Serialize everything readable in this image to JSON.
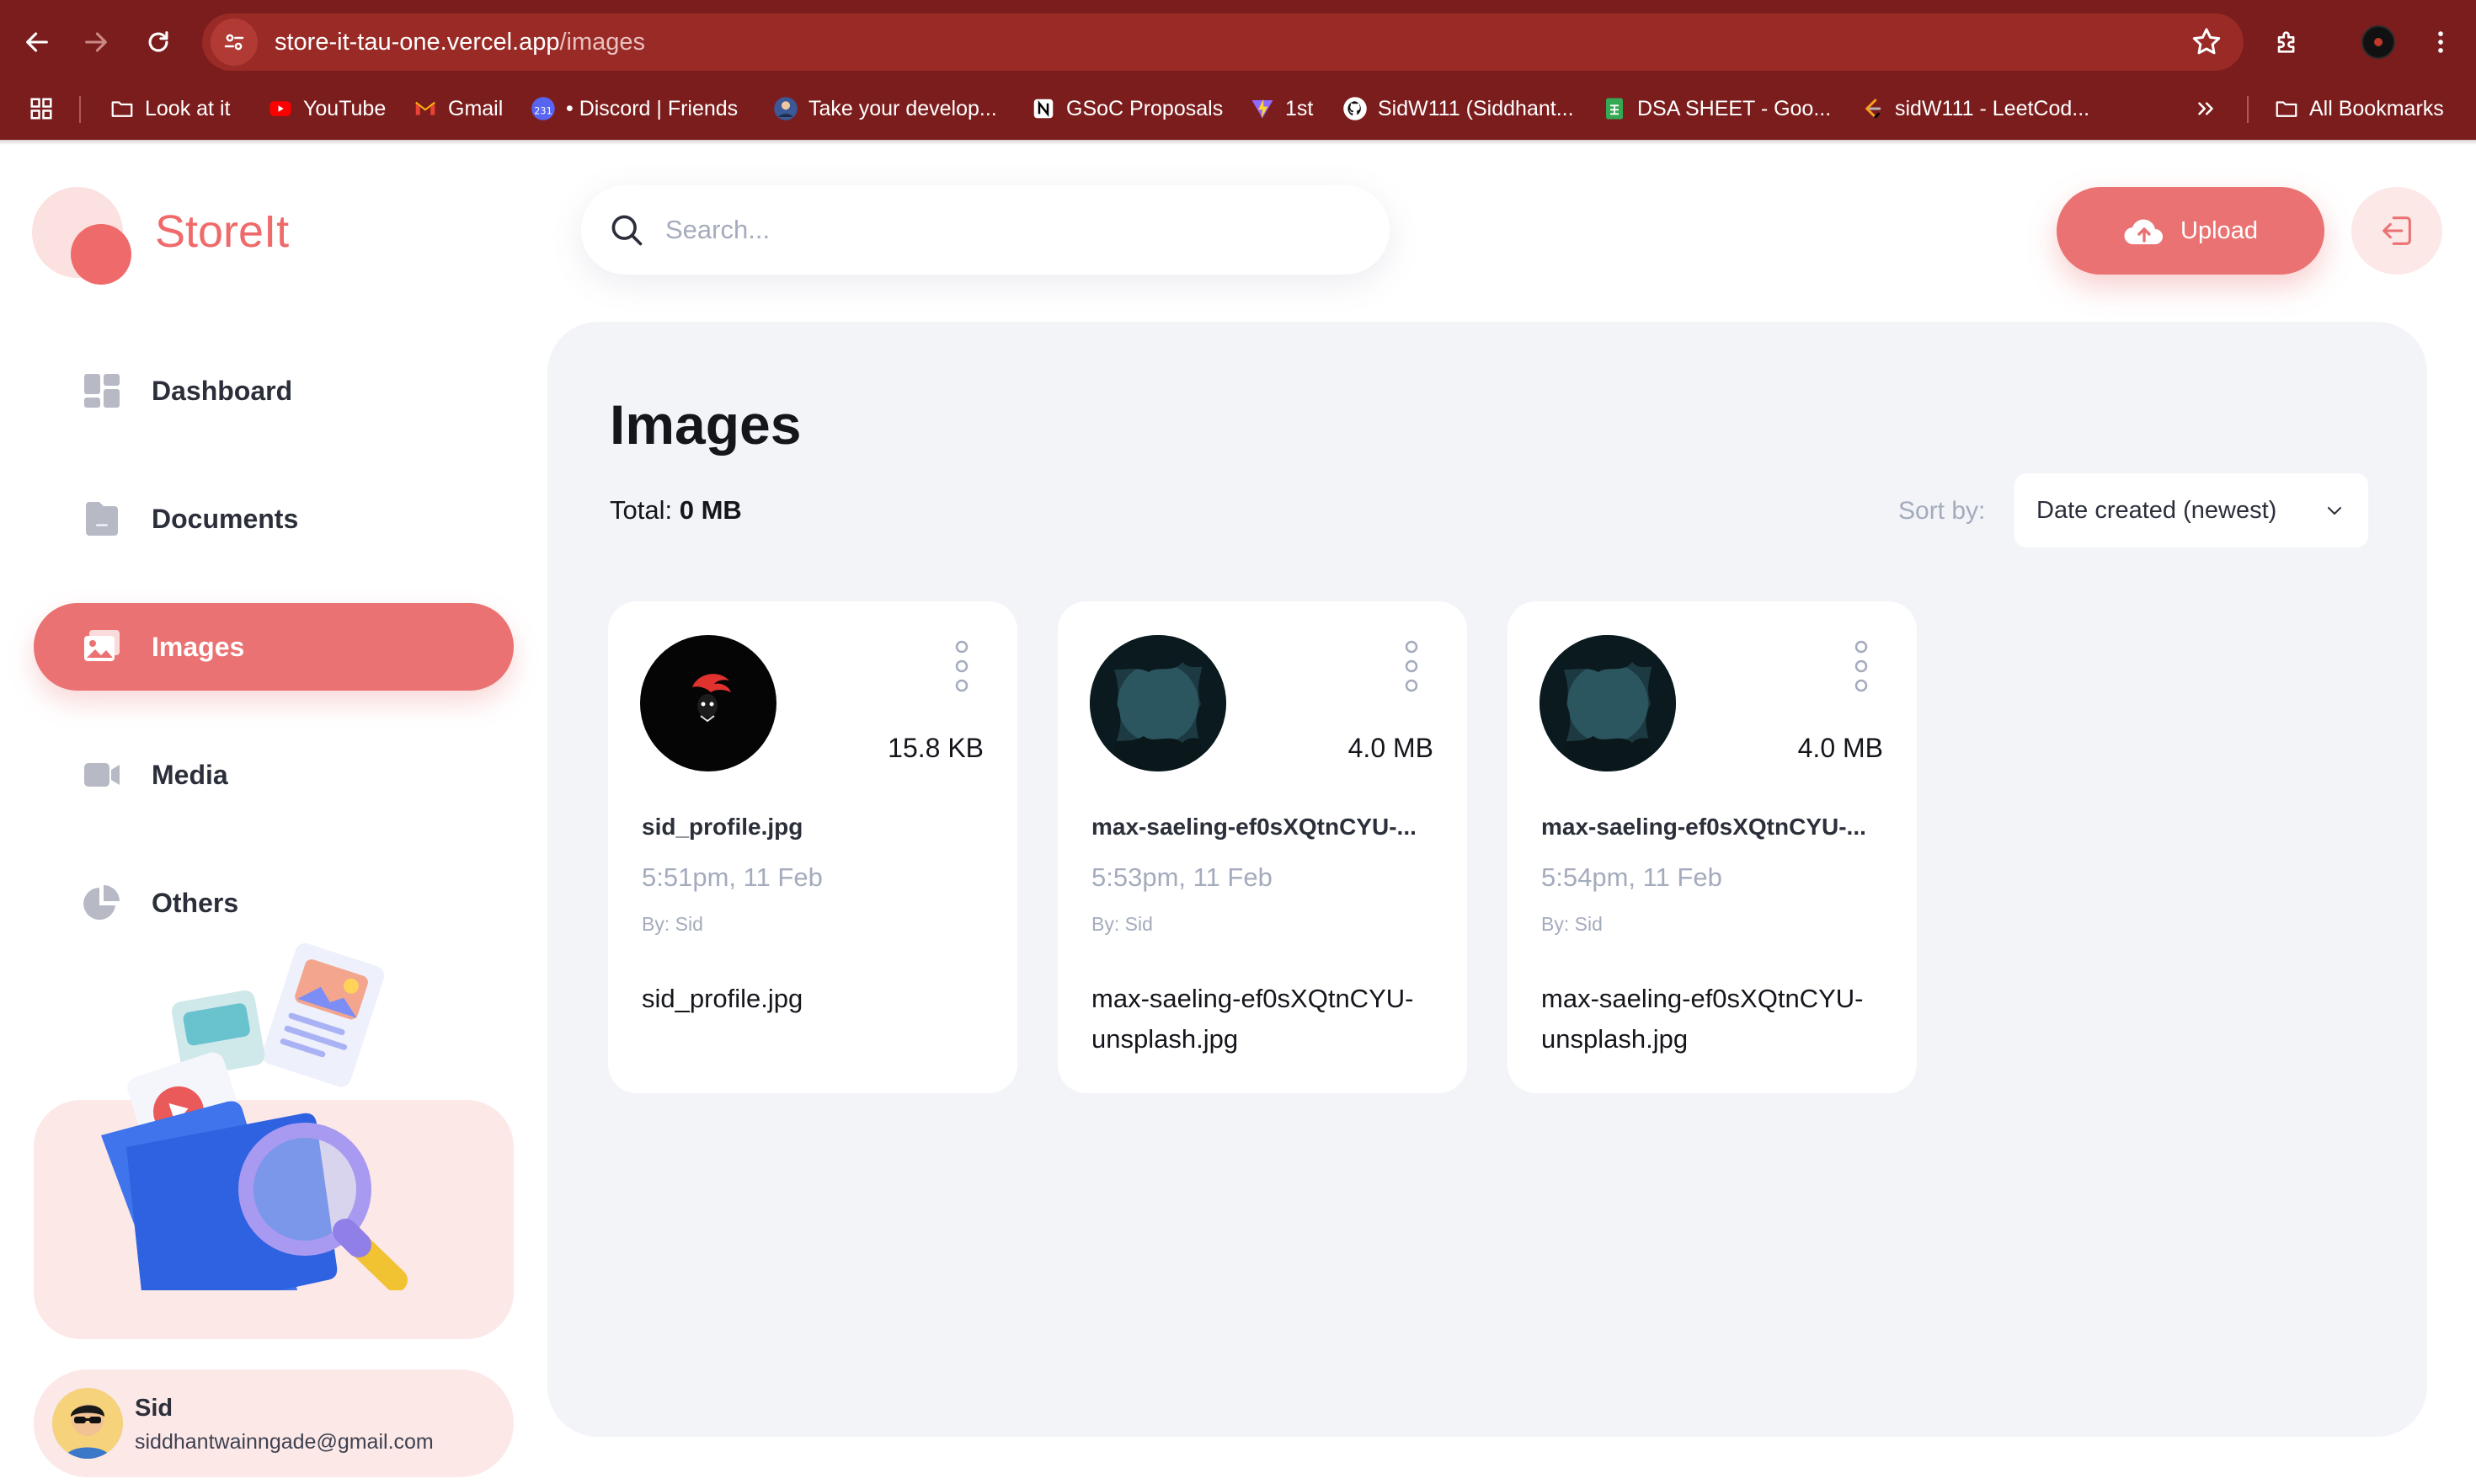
{
  "browser": {
    "url_host": "store-it-tau-one.vercel.app",
    "url_path": "/images",
    "bookmarks": [
      {
        "label": "Look at it",
        "icon": "folder-icon"
      },
      {
        "label": "YouTube",
        "icon": "youtube-icon"
      },
      {
        "label": "Gmail",
        "icon": "gmail-icon"
      },
      {
        "label": "• Discord | Friends",
        "icon": "discord-icon"
      },
      {
        "label": "Take your develop...",
        "icon": "profile-favicon-icon"
      },
      {
        "label": "GSoC Proposals",
        "icon": "notion-icon"
      },
      {
        "label": "1st",
        "icon": "vite-icon"
      },
      {
        "label": "SidW111 (Siddhant...",
        "icon": "github-icon"
      },
      {
        "label": "DSA SHEET - Goo...",
        "icon": "sheets-icon"
      },
      {
        "label": "sidW111 - LeetCod...",
        "icon": "leetcode-icon"
      }
    ],
    "all_bookmarks": "All Bookmarks",
    "colors": {
      "chrome": "#7c1d1d",
      "omnibox": "#9a2a26"
    }
  },
  "app": {
    "name": "StoreIt",
    "accent": "#ea7272"
  },
  "sidebar": {
    "items": [
      {
        "label": "Dashboard",
        "icon": "dashboard-icon",
        "active": false
      },
      {
        "label": "Documents",
        "icon": "documents-icon",
        "active": false
      },
      {
        "label": "Images",
        "icon": "images-icon",
        "active": true
      },
      {
        "label": "Media",
        "icon": "media-icon",
        "active": false
      },
      {
        "label": "Others",
        "icon": "others-icon",
        "active": false
      }
    ],
    "user": {
      "name": "Sid",
      "email": "siddhantwainngade@gmail.com"
    }
  },
  "header": {
    "search_placeholder": "Search...",
    "upload_label": "Upload"
  },
  "main": {
    "title": "Images",
    "total_prefix": "Total:",
    "total_value": "0 MB",
    "sort_label": "Sort by:",
    "sort_value": "Date created (newest)",
    "files": [
      {
        "name": "sid_profile.jpg",
        "full_name": "sid_profile.jpg",
        "size": "15.8 KB",
        "time": "5:51pm, 11 Feb",
        "owner": "By: Sid"
      },
      {
        "name": "max-saeling-ef0sXQtnCYU-...",
        "full_name": "max-saeling-ef0sXQtnCYU-unsplash.jpg",
        "size": "4.0 MB",
        "time": "5:53pm, 11 Feb",
        "owner": "By: Sid"
      },
      {
        "name": "max-saeling-ef0sXQtnCYU-...",
        "full_name": "max-saeling-ef0sXQtnCYU-unsplash.jpg",
        "size": "4.0 MB",
        "time": "5:54pm, 11 Feb",
        "owner": "By: Sid"
      }
    ]
  }
}
